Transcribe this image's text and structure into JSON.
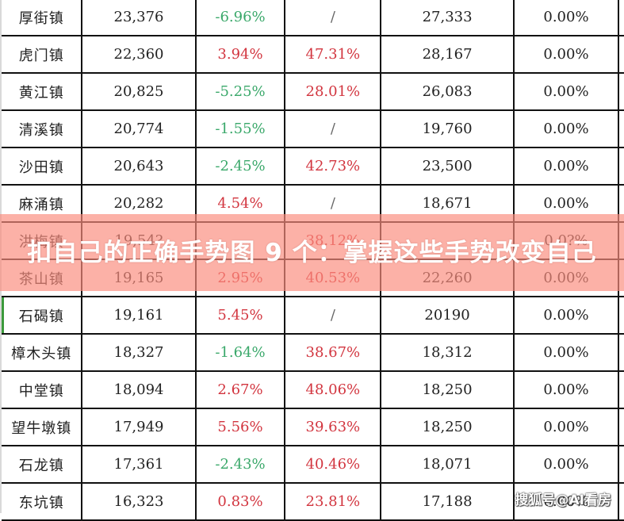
{
  "table": {
    "rows": [
      {
        "town": "厚街镇",
        "value": "23,376",
        "change": "-6.96%",
        "change_sign": "neg",
        "rate": "/",
        "rate_sign": "na",
        "price": "27,333",
        "pct": "0.00%"
      },
      {
        "town": "虎门镇",
        "value": "22,360",
        "change": "3.94%",
        "change_sign": "pos",
        "rate": "47.31%",
        "rate_sign": "pos",
        "price": "28,167",
        "pct": "0.00%"
      },
      {
        "town": "黄江镇",
        "value": "20,825",
        "change": "-5.25%",
        "change_sign": "neg",
        "rate": "28.01%",
        "rate_sign": "pos",
        "price": "26,083",
        "pct": "0.00%"
      },
      {
        "town": "清溪镇",
        "value": "20,774",
        "change": "-1.55%",
        "change_sign": "neg",
        "rate": "/",
        "rate_sign": "na",
        "price": "19,760",
        "pct": "0.00%"
      },
      {
        "town": "沙田镇",
        "value": "20,643",
        "change": "-2.45%",
        "change_sign": "neg",
        "rate": "42.73%",
        "rate_sign": "pos",
        "price": "23,500",
        "pct": "0.00%"
      },
      {
        "town": "麻涌镇",
        "value": "20,282",
        "change": "4.54%",
        "change_sign": "pos",
        "rate": "/",
        "rate_sign": "na",
        "price": "18,671",
        "pct": "0.00%"
      },
      {
        "town": "洪梅镇",
        "value": "19,54?",
        "change": "",
        "change_sign": "pos",
        "rate": "38.12%",
        "rate_sign": "pos",
        "price": "",
        "pct": "0.0?%"
      },
      {
        "town": "茶山镇",
        "value": "19,165",
        "change": "2.95%",
        "change_sign": "pos",
        "rate": "40.53%",
        "rate_sign": "pos",
        "price": "22,260",
        "pct": "0.00%"
      },
      {
        "town": "石碣镇",
        "value": "19,161",
        "change": "5.45%",
        "change_sign": "pos",
        "rate": "/",
        "rate_sign": "na",
        "price": "20190",
        "pct": "0.00%"
      },
      {
        "town": "樟木头镇",
        "value": "18,327",
        "change": "-1.64%",
        "change_sign": "neg",
        "rate": "38.67%",
        "rate_sign": "pos",
        "price": "18,312",
        "pct": "0.00%"
      },
      {
        "town": "中堂镇",
        "value": "18,094",
        "change": "2.67%",
        "change_sign": "pos",
        "rate": "48.06%",
        "rate_sign": "pos",
        "price": "18,250",
        "pct": "0.00%"
      },
      {
        "town": "望牛墩镇",
        "value": "17,949",
        "change": "5.56%",
        "change_sign": "pos",
        "rate": "39.63%",
        "rate_sign": "pos",
        "price": "18,250",
        "pct": "0.00%"
      },
      {
        "town": "石龙镇",
        "value": "17,361",
        "change": "-2.43%",
        "change_sign": "neg",
        "rate": "40.46%",
        "rate_sign": "pos",
        "price": "18,071",
        "pct": "0.00%"
      },
      {
        "town": "东坑镇",
        "value": "16,323",
        "change": "0.83%",
        "change_sign": "pos",
        "rate": "23.81%",
        "rate_sign": "pos",
        "price": "17,188",
        "pct": "0.00%"
      }
    ]
  },
  "banner": {
    "title": "扣自己的正确手势图 9 个：掌握这些手势改变自己"
  },
  "watermark": {
    "text": "搜狐号@AI看房"
  },
  "colors": {
    "negative": "#3aa86a",
    "positive": "#d2353f",
    "banner_bg": "#fa8c7d",
    "grid_line": "#111111"
  }
}
